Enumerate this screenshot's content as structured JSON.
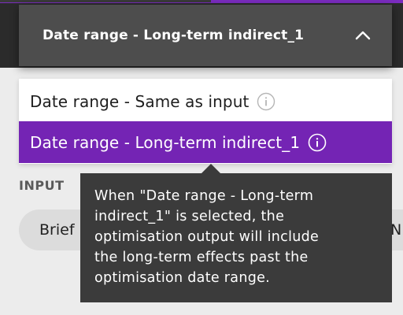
{
  "dropdown": {
    "selected_label": "Date range - Long-term indirect_1",
    "expanded_icon": "chevron-up-icon",
    "options": [
      {
        "label": "Date range - Same as input",
        "icon": "info-icon",
        "selected": false
      },
      {
        "label": "Date range - Long-term indirect_1",
        "icon": "info-icon",
        "selected": true
      }
    ]
  },
  "tooltip": {
    "lines": [
      "When \"Date range - Long-term",
      "indirect_1\" is selected, the",
      "optimisation output will include",
      "the long-term effects past the",
      "optimisation date range."
    ]
  },
  "background": {
    "section_label": "INPUT",
    "pill_left_text": "Brief",
    "pill_right_text": "N"
  },
  "colors": {
    "accent": "#7424b4",
    "trigger_bg": "#4d4d4d",
    "tooltip_bg": "#3b3b3b"
  }
}
